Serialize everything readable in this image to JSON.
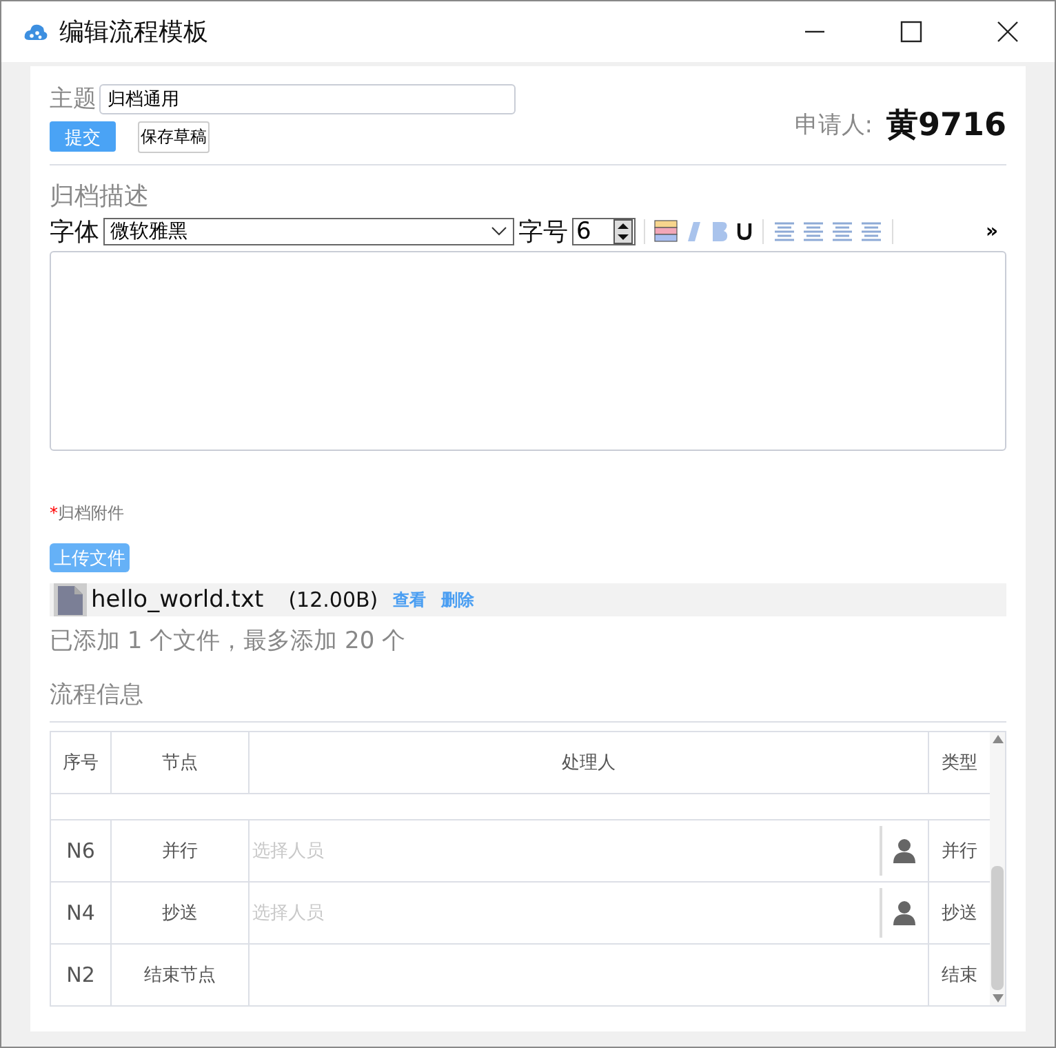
{
  "window": {
    "title": "编辑流程模板"
  },
  "subject": {
    "label": "主题",
    "value": "归档通用"
  },
  "buttons": {
    "submit": "提交",
    "save_draft": "保存草稿"
  },
  "applicant": {
    "label": "申请人:",
    "name": "黄9716"
  },
  "description": {
    "title": "归档描述",
    "font_label": "字体",
    "font_value": "微软雅黑",
    "size_label": "字号",
    "size_value": "6",
    "more": "»"
  },
  "attachments": {
    "required_mark": "*",
    "title": "归档附件",
    "upload": "上传文件",
    "files": [
      {
        "name": "hello_world.txt",
        "size": "(12.00B)",
        "view": "查看",
        "delete": "删除"
      }
    ],
    "summary": "已添加 1 个文件，最多添加 20 个"
  },
  "flow": {
    "title": "流程信息",
    "columns": [
      "序号",
      "节点",
      "处理人",
      "类型"
    ],
    "rows": [
      {
        "id": "N6",
        "node": "并行",
        "kind": "picker",
        "handler_placeholder": "选择人员",
        "type": "并行"
      },
      {
        "id": "N4",
        "node": "抄送",
        "kind": "picker",
        "handler_placeholder": "选择人员",
        "type": "抄送"
      },
      {
        "id": "N2",
        "node": "结束节点",
        "kind": "none",
        "type": "结束"
      }
    ]
  }
}
